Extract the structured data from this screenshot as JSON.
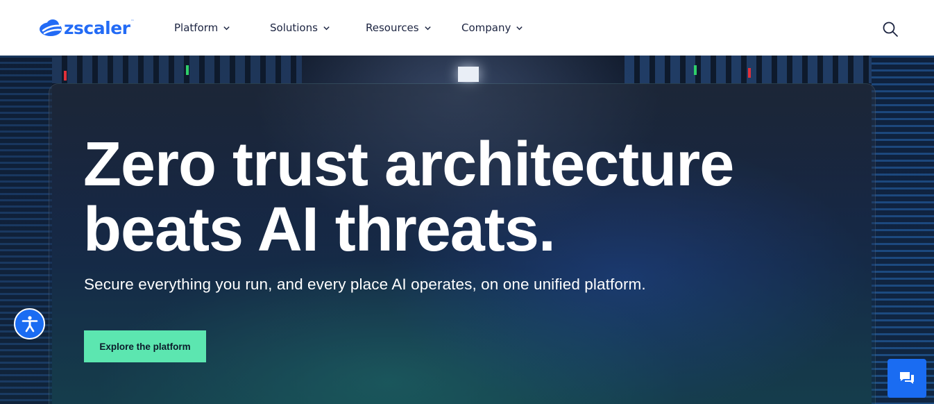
{
  "brand": {
    "logo_text": "zscaler",
    "logo_tm": "™",
    "accent_color": "#236bf5",
    "cta_color": "#5ce6b0"
  },
  "header": {
    "nav": [
      {
        "label": "Platform",
        "icon": "chevron-down-icon"
      },
      {
        "label": "Solutions",
        "icon": "chevron-down-icon"
      },
      {
        "label": "Resources",
        "icon": "chevron-down-icon"
      },
      {
        "label": "Company",
        "icon": "chevron-down-icon"
      }
    ],
    "search_icon": "search-icon"
  },
  "hero": {
    "headline_line1": "Zero trust architecture",
    "headline_line2": "beats AI threats.",
    "subheadline": "Secure everything you run, and every place AI operates, on one unified platform.",
    "cta_label": "Explore the platform"
  },
  "widgets": {
    "accessibility_icon": "accessibility-icon",
    "chat_icon": "chat-icon"
  }
}
